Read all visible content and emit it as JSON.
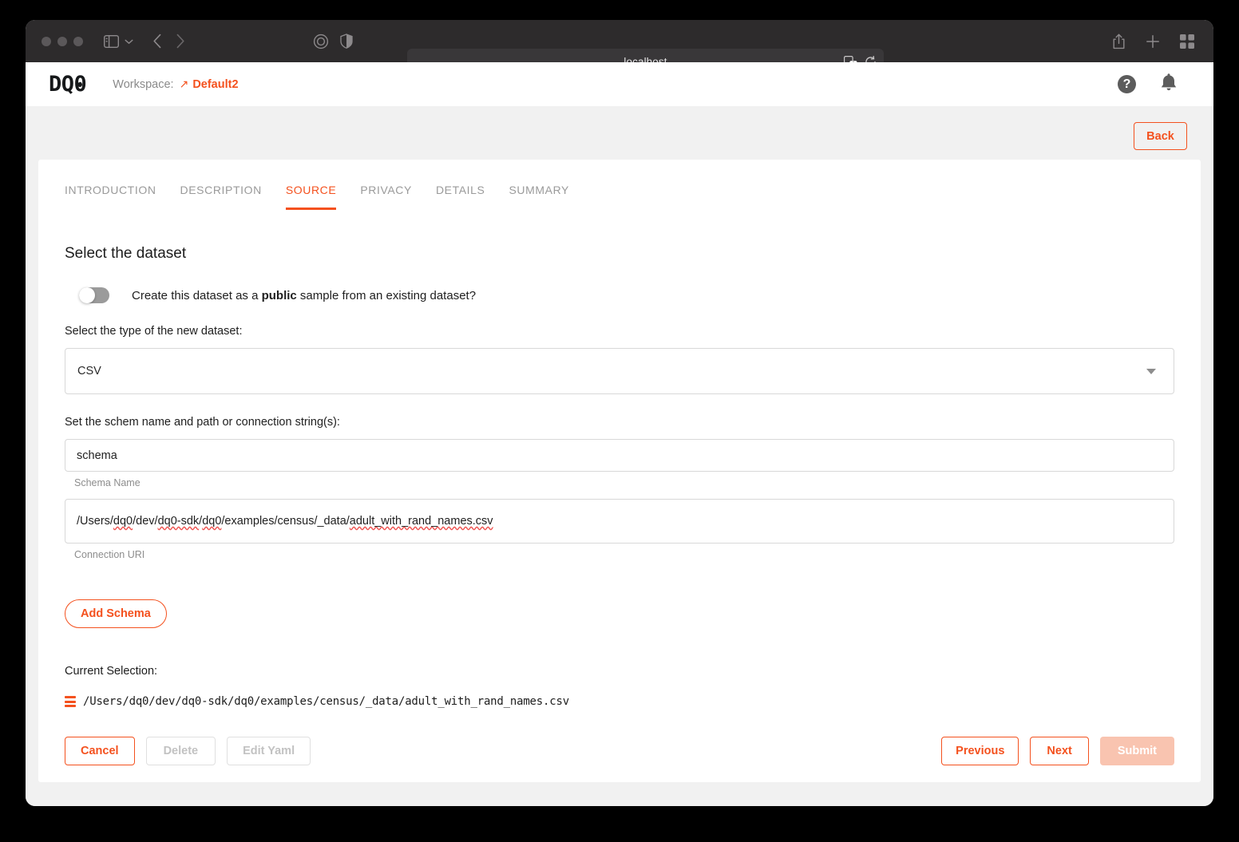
{
  "browser": {
    "url": "localhost",
    "icons": {
      "sidebar": "sidebar-icon",
      "chevron": "chevron-down-icon",
      "back": "back-arrow-icon",
      "forward": "forward-arrow-icon",
      "reader": "reader-view-icon",
      "shield": "privacy-shield-icon",
      "translate": "translate-icon",
      "reload": "reload-icon",
      "share": "share-icon",
      "new_tab": "plus-icon",
      "tab_overview": "tab-overview-icon"
    }
  },
  "app_header": {
    "logo": "DQ0",
    "workspace_label": "Workspace:",
    "workspace_arrow": "↗",
    "workspace_value": "Default2",
    "help_glyph": "?",
    "help_name": "help-icon",
    "bell_name": "notification-bell-icon"
  },
  "toolbar": {
    "back_label": "Back"
  },
  "tabs": [
    {
      "label": "INTRODUCTION",
      "active": false
    },
    {
      "label": "DESCRIPTION",
      "active": false
    },
    {
      "label": "SOURCE",
      "active": true
    },
    {
      "label": "PRIVACY",
      "active": false
    },
    {
      "label": "DETAILS",
      "active": false
    },
    {
      "label": "SUMMARY",
      "active": false
    }
  ],
  "form": {
    "section_title": "Select the dataset",
    "toggle": {
      "state": "off",
      "label_before": "Create this dataset as a ",
      "label_bold": "public",
      "label_after": " sample from an existing dataset?"
    },
    "type_label": "Select the type of the new dataset:",
    "type_value": "CSV",
    "schema_label": "Set the schem name and path or connection string(s):",
    "schema_name_value": "schema",
    "schema_name_placeholder": "Schema Name",
    "schema_name_helper": "Schema Name",
    "connection_uri_value": "/Users/dq0/dev/dq0-sdk/dq0/examples/census/_data/adult_with_rand_names.csv",
    "connection_uri_helper": "Connection URI",
    "connection_uri_parts": [
      {
        "text": "/Users/",
        "spell": false
      },
      {
        "text": "dq0",
        "spell": true
      },
      {
        "text": "/dev/",
        "spell": false
      },
      {
        "text": "dq0-sdk",
        "spell": true
      },
      {
        "text": "/",
        "spell": false
      },
      {
        "text": "dq0",
        "spell": true
      },
      {
        "text": "/examples/census/_data/",
        "spell": false
      },
      {
        "text": "adult_with_rand_names.csv",
        "spell": true
      }
    ],
    "add_schema_label": "Add Schema",
    "current_selection_label": "Current Selection:",
    "current_selection_path": "/Users/dq0/dev/dq0-sdk/dq0/examples/census/_data/adult_with_rand_names.csv"
  },
  "footer": {
    "cancel": "Cancel",
    "delete": "Delete",
    "edit_yaml": "Edit Yaml",
    "previous": "Previous",
    "next": "Next",
    "submit": "Submit"
  },
  "colors": {
    "accent": "#f4511e",
    "accent_disabled": "#f9c4b0",
    "titlebar": "#2d2b2c",
    "page_bg": "#f1f1f1"
  }
}
